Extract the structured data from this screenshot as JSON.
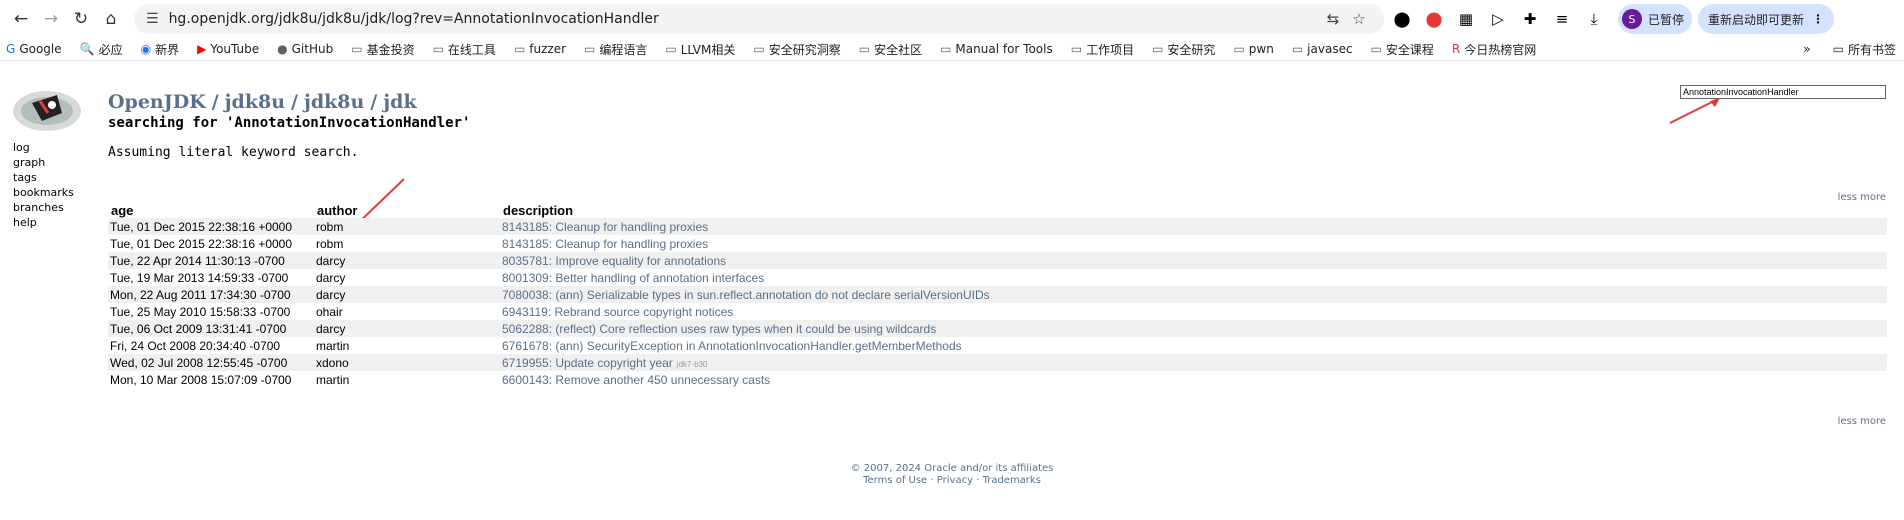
{
  "browser": {
    "url": "hg.openjdk.org/jdk8u/jdk8u/jdk/log?rev=AnnotationInvocationHandler",
    "profile_label": "已暂停",
    "profile_initial": "S",
    "update_label": "重新启动即可更新"
  },
  "bookmarks": [
    {
      "label": "Google",
      "icon": "google-icon"
    },
    {
      "label": "必应",
      "icon": "bing-icon"
    },
    {
      "label": "新界",
      "icon": "globe-icon"
    },
    {
      "label": "YouTube",
      "icon": "youtube-icon"
    },
    {
      "label": "GitHub",
      "icon": "github-icon"
    },
    {
      "label": "基金投资",
      "icon": "folder-icon"
    },
    {
      "label": "在线工具",
      "icon": "folder-icon"
    },
    {
      "label": "fuzzer",
      "icon": "folder-icon"
    },
    {
      "label": "编程语言",
      "icon": "folder-icon"
    },
    {
      "label": "LLVM相关",
      "icon": "folder-icon"
    },
    {
      "label": "安全研究洞察",
      "icon": "folder-icon"
    },
    {
      "label": "安全社区",
      "icon": "folder-icon"
    },
    {
      "label": "Manual for Tools",
      "icon": "folder-icon"
    },
    {
      "label": "工作项目",
      "icon": "folder-icon"
    },
    {
      "label": "安全研究",
      "icon": "folder-icon"
    },
    {
      "label": "pwn",
      "icon": "folder-icon"
    },
    {
      "label": "javasec",
      "icon": "folder-icon"
    },
    {
      "label": "安全课程",
      "icon": "folder-icon"
    },
    {
      "label": "今日热榜官网",
      "icon": "rebang-icon"
    }
  ],
  "all_bookmarks_label": "所有书签",
  "side_nav": [
    "log",
    "graph",
    "tags",
    "bookmarks",
    "branches",
    "help"
  ],
  "breadcrumb": {
    "root": "OpenJDK",
    "p1": "jdk8u",
    "p2": "jdk8u",
    "p3": "jdk",
    "sep": "/"
  },
  "search_title": "searching for 'AnnotationInvocationHandler'",
  "assume_text": "Assuming literal keyword search.",
  "search_value": "AnnotationInvocationHandler",
  "less_more": "less more",
  "table": {
    "headers": {
      "age": "age",
      "author": "author",
      "description": "description"
    },
    "rows": [
      {
        "age": "Tue, 01 Dec 2015 22:38:16 +0000",
        "author": "robm",
        "desc": "8143185: Cleanup for handling proxies",
        "tag": ""
      },
      {
        "age": "Tue, 01 Dec 2015 22:38:16 +0000",
        "author": "robm",
        "desc": "8143185: Cleanup for handling proxies",
        "tag": ""
      },
      {
        "age": "Tue, 22 Apr 2014 11:30:13 -0700",
        "author": "darcy",
        "desc": "8035781: Improve equality for annotations",
        "tag": ""
      },
      {
        "age": "Tue, 19 Mar 2013 14:59:33 -0700",
        "author": "darcy",
        "desc": "8001309: Better handling of annotation interfaces",
        "tag": ""
      },
      {
        "age": "Mon, 22 Aug 2011 17:34:30 -0700",
        "author": "darcy",
        "desc": "7080038: (ann) Serializable types in sun.reflect.annotation do not declare serialVersionUIDs",
        "tag": ""
      },
      {
        "age": "Tue, 25 May 2010 15:58:33 -0700",
        "author": "ohair",
        "desc": "6943119: Rebrand source copyright notices",
        "tag": ""
      },
      {
        "age": "Tue, 06 Oct 2009 13:31:41 -0700",
        "author": "darcy",
        "desc": "5062288: (reflect) Core reflection uses raw types when it could be using wildcards",
        "tag": ""
      },
      {
        "age": "Fri, 24 Oct 2008 20:34:40 -0700",
        "author": "martin",
        "desc": "6761678: (ann) SecurityException in AnnotationInvocationHandler.getMemberMethods",
        "tag": ""
      },
      {
        "age": "Wed, 02 Jul 2008 12:55:45 -0700",
        "author": "xdono",
        "desc": "6719955: Update copyright year",
        "tag": "jdk7-b30"
      },
      {
        "age": "Mon, 10 Mar 2008 15:07:09 -0700",
        "author": "martin",
        "desc": "6600143: Remove another 450 unnecessary casts",
        "tag": ""
      }
    ]
  },
  "footer": {
    "line1": "© 2007, 2024 Oracle and/or its affiliates",
    "terms": "Terms of Use",
    "privacy": "Privacy",
    "trademarks": "Trademarks",
    "dot": "·"
  },
  "colors": {
    "link": "#58708a",
    "annotation_arrow": "#e53935"
  }
}
